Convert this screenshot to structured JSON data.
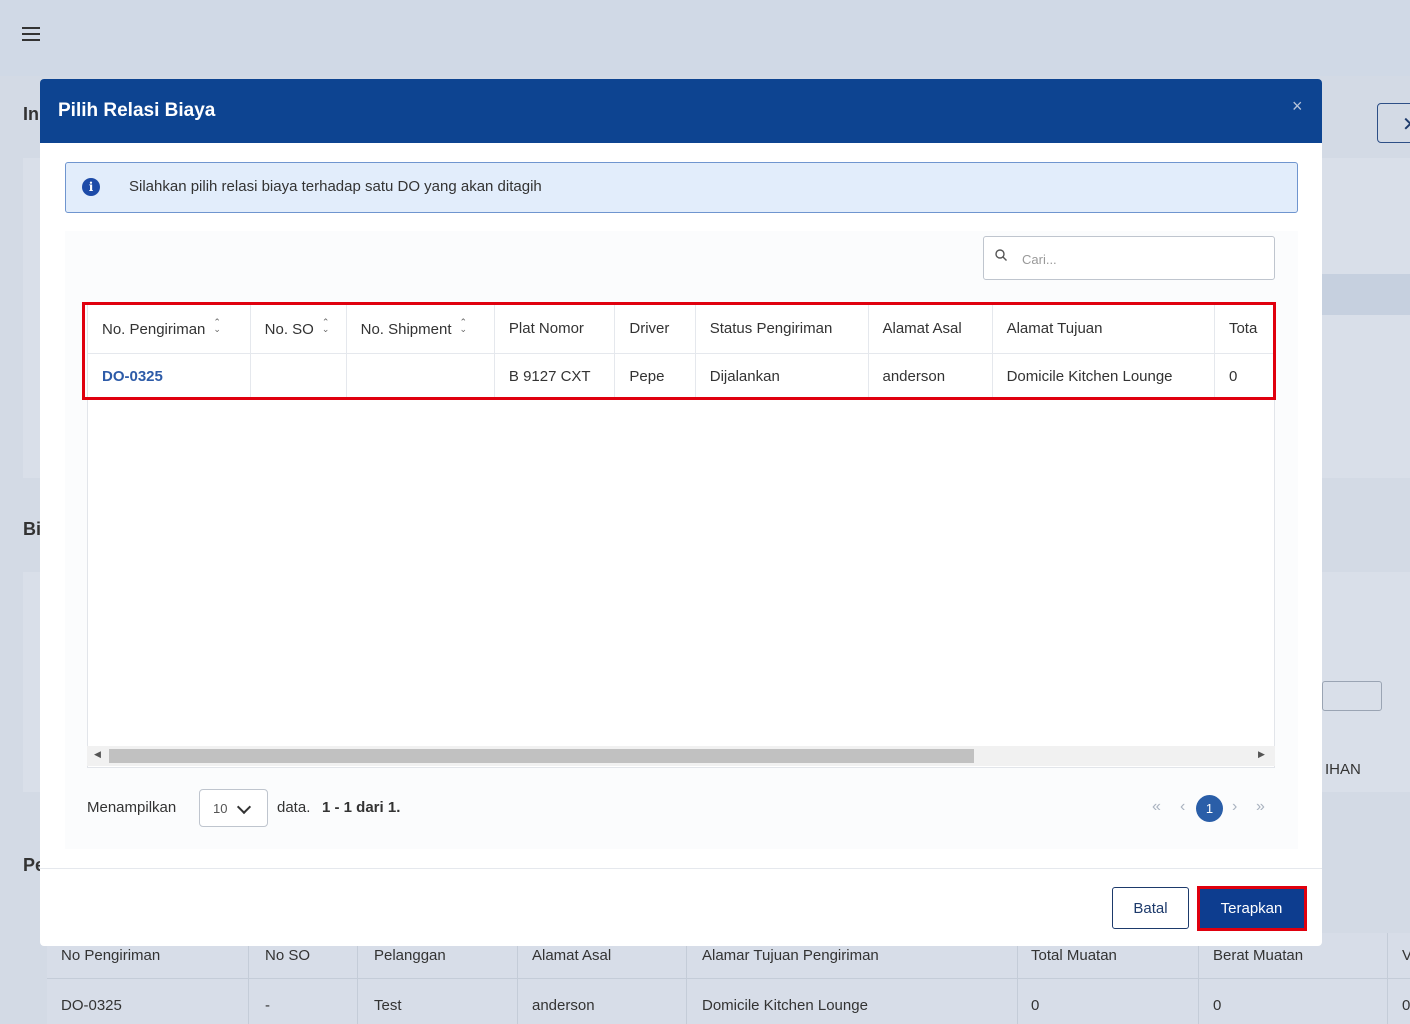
{
  "background": {
    "headings": [
      "In",
      "Bi",
      "Pe"
    ],
    "side_text": "IHAN",
    "table": {
      "columns": [
        "No Pengiriman",
        "No SO",
        "Pelanggan",
        "Alamat Asal",
        "Alamar Tujuan Pengiriman",
        "Total Muatan",
        "Berat Muatan",
        "V"
      ],
      "row": [
        "DO-0325",
        "-",
        "Test",
        "anderson",
        "Domicile Kitchen Lounge",
        "0",
        "0",
        "0"
      ]
    }
  },
  "modal": {
    "title": "Pilih Relasi Biaya",
    "close_glyph": "×",
    "info_text": "Silahkan pilih relasi biaya terhadap satu DO yang akan ditagih",
    "search_placeholder": "Cari...",
    "table": {
      "columns": [
        {
          "label": "No. Pengiriman",
          "sortable": true
        },
        {
          "label": "No. SO",
          "sortable": true
        },
        {
          "label": "No. Shipment",
          "sortable": true
        },
        {
          "label": "Plat Nomor",
          "sortable": false
        },
        {
          "label": "Driver",
          "sortable": false
        },
        {
          "label": "Status Pengiriman",
          "sortable": false
        },
        {
          "label": "Alamat Asal",
          "sortable": false
        },
        {
          "label": "Alamat Tujuan",
          "sortable": false
        },
        {
          "label": "Tota",
          "sortable": false
        }
      ],
      "rows": [
        [
          "DO-0325",
          "",
          "",
          "B 9127 CXT",
          "Pepe",
          "Dijalankan",
          "anderson",
          "Domicile Kitchen Lounge",
          "0"
        ]
      ]
    },
    "footer": {
      "showing_label": "Menampilkan",
      "page_size": "10",
      "data_label": "data.",
      "range": "1 - 1 dari 1.",
      "current_page": "1",
      "first_glyph": "«",
      "prev_glyph": "‹",
      "next_glyph": "›",
      "last_glyph": "»"
    },
    "buttons": {
      "cancel": "Batal",
      "apply": "Terapkan"
    }
  },
  "colors": {
    "header_blue": "#0d4491",
    "highlight_red": "#e0000e",
    "link_blue": "#2d5ba8"
  }
}
